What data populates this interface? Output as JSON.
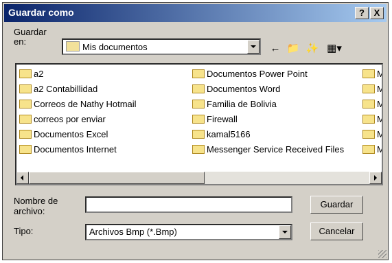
{
  "window": {
    "title": "Guardar como",
    "help_label": "?",
    "close_label": "X"
  },
  "save_in": {
    "label": "Guardar en:",
    "value": "Mis documentos"
  },
  "toolbar": {
    "back_icon": "back-arrow-icon",
    "up_icon": "up-folder-icon",
    "new_folder_icon": "new-folder-icon",
    "views_icon": "views-menu-icon"
  },
  "files": {
    "col1": [
      "a2",
      "a2 Contabillidad",
      "Correos de Nathy Hotmail",
      "correos por enviar",
      "Documentos Excel",
      "Documentos Internet"
    ],
    "col2": [
      "Documentos Power Point",
      "Documentos Word",
      "Familia de Bolivia",
      "Firewall",
      "kamal5166",
      "Messenger Service Received Files"
    ],
    "col3": [
      "M",
      "M",
      "M",
      "M",
      "M",
      "M"
    ]
  },
  "filename": {
    "label": "Nombre de archivo:",
    "value": ""
  },
  "filetype": {
    "label": "Tipo:",
    "value": "Archivos Bmp (*.Bmp)"
  },
  "buttons": {
    "save": "Guardar",
    "cancel": "Cancelar"
  }
}
